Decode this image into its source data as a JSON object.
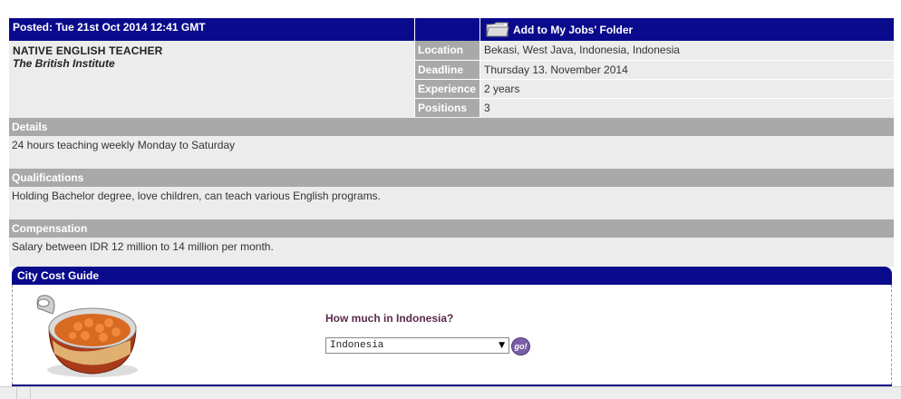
{
  "header": {
    "posted": "Posted: Tue 21st Oct 2014 12:41 GMT",
    "add_folder_label": "Add to My Jobs' Folder"
  },
  "job": {
    "title": "NATIVE ENGLISH TEACHER",
    "company": "The British Institute"
  },
  "info": [
    {
      "label": "Location",
      "value": "Bekasi, West Java, Indonesia, Indonesia"
    },
    {
      "label": "Deadline",
      "value": "Thursday 13. November 2014"
    },
    {
      "label": "Experience",
      "value": "2 years"
    },
    {
      "label": "Positions",
      "value": "3"
    }
  ],
  "sections": [
    {
      "title": "Details",
      "body": "24 hours teaching weekly Monday to Saturday"
    },
    {
      "title": "Qualifications",
      "body": "Holding Bachelor degree, love children, can teach various English programs."
    },
    {
      "title": "Compensation",
      "body": "Salary between IDR 12 million to 14 million per month."
    }
  ],
  "city_guide": {
    "title": "City Cost Guide",
    "question": "How much in Indonesia?",
    "selected_country": "Indonesia",
    "go_label": "go!"
  },
  "colors": {
    "navy": "#0a0a8c",
    "grey_label": "#a9a9a9",
    "light_bg": "#ececec"
  }
}
